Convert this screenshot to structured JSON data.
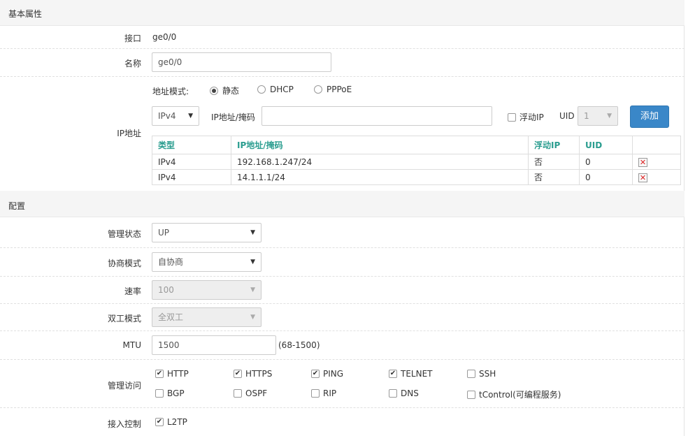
{
  "sections": {
    "basic": "基本属性",
    "config": "配置"
  },
  "interface": {
    "label": "接口",
    "value": "ge0/0"
  },
  "name": {
    "label": "名称",
    "value": "ge0/0"
  },
  "ip": {
    "label": "IP地址",
    "mode_label": "地址模式:",
    "modes": [
      "静态",
      "DHCP",
      "PPPoE"
    ],
    "selected_mode": "静态",
    "version": "IPv4",
    "mask_label": "IP地址/掩码",
    "mask_value": "",
    "floating_label": "浮动IP",
    "uid_label": "UID",
    "uid_value": "1",
    "add_button": "添加",
    "table": {
      "headers": [
        "类型",
        "IP地址/掩码",
        "浮动IP",
        "UID",
        ""
      ],
      "rows": [
        [
          "IPv4",
          "192.168.1.247/24",
          "否",
          "0"
        ],
        [
          "IPv4",
          "14.1.1.1/24",
          "否",
          "0"
        ]
      ]
    }
  },
  "admin_status": {
    "label": "管理状态",
    "value": "UP"
  },
  "negotiation": {
    "label": "协商模式",
    "value": "自协商"
  },
  "speed": {
    "label": "速率",
    "value": "100"
  },
  "duplex": {
    "label": "双工模式",
    "value": "全双工"
  },
  "mtu": {
    "label": "MTU",
    "value": "1500",
    "hint": "(68-1500)"
  },
  "mgmt_access": {
    "label": "管理访问",
    "options": [
      {
        "name": "HTTP",
        "checked": true
      },
      {
        "name": "HTTPS",
        "checked": true
      },
      {
        "name": "PING",
        "checked": true
      },
      {
        "name": "TELNET",
        "checked": true
      },
      {
        "name": "SSH",
        "checked": false
      },
      {
        "name": "BGP",
        "checked": false
      },
      {
        "name": "OSPF",
        "checked": false
      },
      {
        "name": "RIP",
        "checked": false
      },
      {
        "name": "DNS",
        "checked": false
      },
      {
        "name": "tControl(可编程服务)",
        "checked": false
      }
    ]
  },
  "access_control": {
    "label": "接入控制",
    "options": [
      {
        "name": "L2TP",
        "checked": true
      }
    ]
  }
}
